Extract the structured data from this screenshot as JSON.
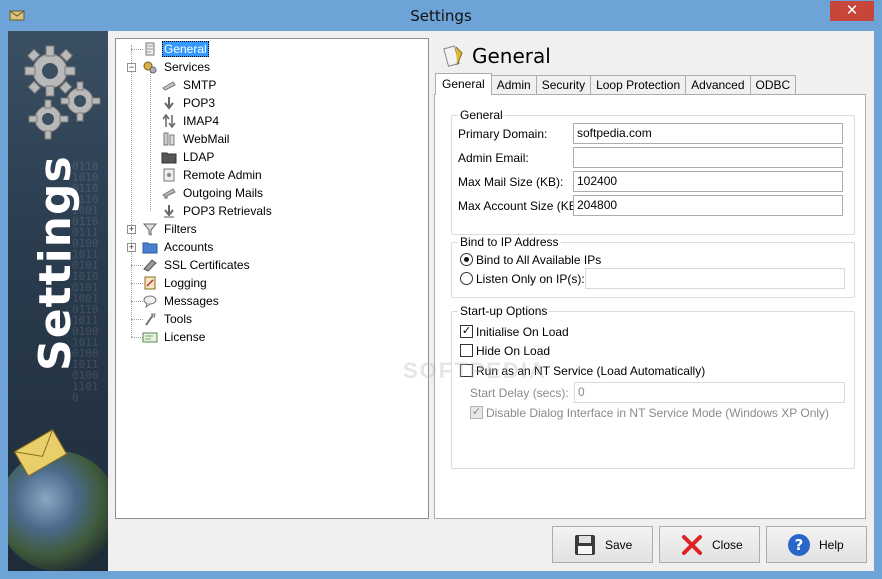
{
  "window": {
    "title": "Settings",
    "close_glyph": "✕"
  },
  "banner": {
    "text": "Settings",
    "binary": "0110101001101110100101100111010010110101101001011001011010110100101101001011010011010"
  },
  "tree": {
    "items": [
      {
        "label": "General",
        "icon": "general-icon",
        "selected": true
      },
      {
        "label": "Services",
        "icon": "services-icon"
      },
      {
        "label": "SMTP",
        "icon": "smtp-icon"
      },
      {
        "label": "POP3",
        "icon": "pop3-icon"
      },
      {
        "label": "IMAP4",
        "icon": "imap4-icon"
      },
      {
        "label": "WebMail",
        "icon": "webmail-icon"
      },
      {
        "label": "LDAP",
        "icon": "folder-icon"
      },
      {
        "label": "Remote Admin",
        "icon": "remote-admin-icon"
      },
      {
        "label": "Outgoing Mails",
        "icon": "outgoing-mails-icon"
      },
      {
        "label": "POP3 Retrievals",
        "icon": "pop3-retrievals-icon"
      },
      {
        "label": "Filters",
        "icon": "filters-icon"
      },
      {
        "label": "Accounts",
        "icon": "folder-icon"
      },
      {
        "label": "SSL Certificates",
        "icon": "ssl-certificate-icon"
      },
      {
        "label": "Logging",
        "icon": "logging-icon"
      },
      {
        "label": "Messages",
        "icon": "messages-icon"
      },
      {
        "label": "Tools",
        "icon": "tools-icon"
      },
      {
        "label": "License",
        "icon": "license-icon"
      }
    ],
    "expander_minus": "−",
    "expander_plus": "+"
  },
  "panel": {
    "title": "General",
    "tabs": [
      "General",
      "Admin",
      "Security",
      "Loop Protection",
      "Advanced",
      "ODBC"
    ],
    "general_group": {
      "title": "General",
      "primary_domain_label": "Primary Domain:",
      "primary_domain_value": "softpedia.com",
      "admin_email_label": "Admin Email:",
      "admin_email_value": "",
      "max_mail_size_label": "Max Mail Size (KB):",
      "max_mail_size_value": "102400",
      "max_account_size_label": "Max Account Size (KB):",
      "max_account_size_value": "204800"
    },
    "bind_group": {
      "title": "Bind to IP Address",
      "option_all": "Bind to All Available IPs",
      "option_only": "Listen Only on IP(s):",
      "ip_value": ""
    },
    "startup_group": {
      "title": "Start-up Options",
      "initialise_label": "Initialise On Load",
      "hide_label": "Hide On Load",
      "nt_service_label": "Run as an NT Service (Load Automatically)",
      "start_delay_label": "Start Delay (secs):",
      "start_delay_value": "0",
      "disable_dialog_label": "Disable Dialog Interface in NT Service Mode (Windows XP Only)",
      "check_glyph": "✓"
    },
    "watermark": "SOFTPEDIA"
  },
  "buttons": {
    "save": "Save",
    "close": "Close",
    "help": "Help"
  },
  "colors": {
    "titlebar": "#6ea3d8",
    "close": "#c7463a",
    "selection": "#3399ff"
  }
}
